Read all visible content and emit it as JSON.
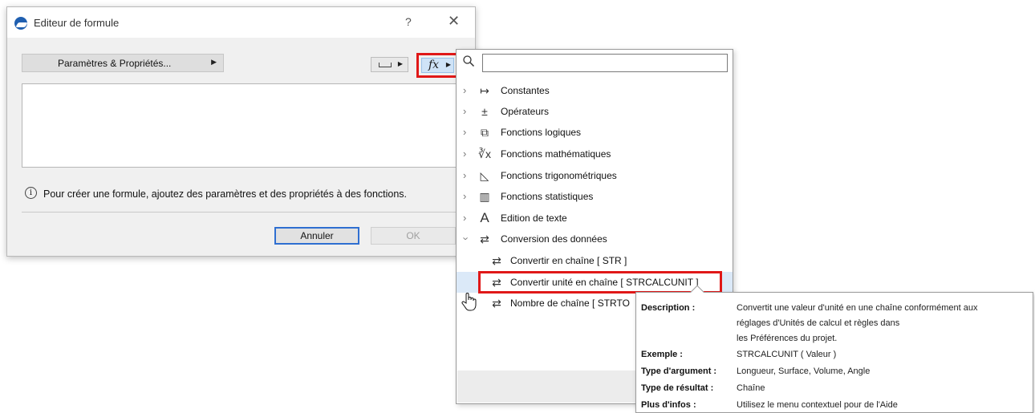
{
  "dialog": {
    "title": "Editeur de formule",
    "help_glyph": "?",
    "close_glyph": "✕",
    "params_label": "Paramètres & Propriétés...",
    "info_text": "Pour créer une formule, ajoutez des paramètres et des propriétés à des fonctions.",
    "cancel_label": "Annuler",
    "ok_label": "OK",
    "fx_label": "fx"
  },
  "panel": {
    "search_placeholder": "",
    "categories": [
      {
        "label": "Constantes",
        "icon": "constants-icon",
        "glyph": "↦"
      },
      {
        "label": "Opérateurs",
        "icon": "operators-icon",
        "glyph": "±"
      },
      {
        "label": "Fonctions logiques",
        "icon": "logic-puzzle-icon",
        "glyph": "⧉"
      },
      {
        "label": "Fonctions mathématiques",
        "icon": "root-x-icon",
        "glyph": "∛x"
      },
      {
        "label": "Fonctions trigonométriques",
        "icon": "triangle-angle-icon",
        "glyph": "◺"
      },
      {
        "label": "Fonctions statistiques",
        "icon": "statistics-bars-icon",
        "glyph": "▥"
      },
      {
        "label": "Edition de texte",
        "icon": "letter-a-icon",
        "glyph": "A"
      },
      {
        "label": "Conversion des données",
        "icon": "conversion-icon",
        "glyph": "⇄"
      }
    ],
    "children": [
      {
        "label": "Convertir en chaîne [ STR ]"
      },
      {
        "label": "Convertir unité en chaîne [ STRCALCUNIT ]"
      },
      {
        "label": "Nombre de chaîne [ STRTO"
      }
    ]
  },
  "tooltip": {
    "description_key": "Description :",
    "description_lines": [
      "Convertit une valeur d'unité en une chaîne conformément aux",
      "réglages d'Unités de calcul et règles dans",
      "les Préférences du projet."
    ],
    "example_key": "Exemple :",
    "example_val": "STRCALCUNIT ( Valeur )",
    "arg_key": "Type d'argument :",
    "arg_val": "Longueur, Surface, Volume, Angle",
    "result_key": "Type de résultat :",
    "result_val": "Chaîne",
    "more_key": "Plus d'infos :",
    "more_val": "Utilisez le menu contextuel pour de l'Aide"
  },
  "colors": {
    "highlight_red": "#e01818",
    "selection_blue": "#dbe9f8",
    "default_button_border": "#2f6fd1"
  }
}
